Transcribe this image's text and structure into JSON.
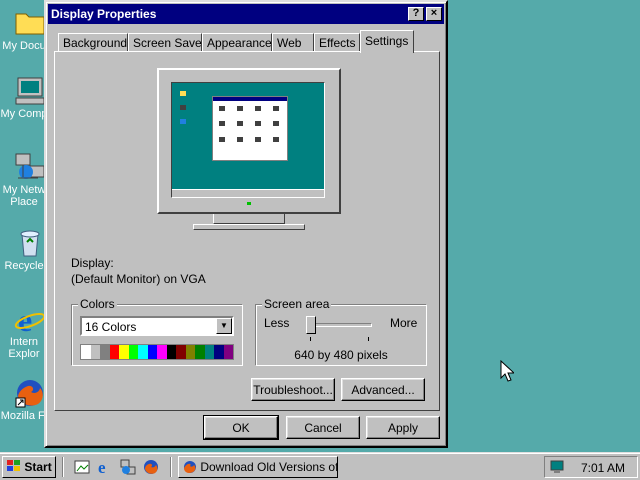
{
  "desktop": {
    "icons": [
      {
        "label": "My Docu",
        "icon": "folder-icon"
      },
      {
        "label": "My Comp",
        "icon": "computer-icon"
      },
      {
        "label": "My Netw",
        "label2": "Place",
        "icon": "network-icon"
      },
      {
        "label": "Recycle",
        "icon": "recycle-bin-icon"
      },
      {
        "label": "Intern",
        "label2": "Explor",
        "icon": "internet-explorer-icon"
      },
      {
        "label": "Mozilla Fi",
        "icon": "firefox-icon"
      }
    ]
  },
  "window": {
    "title": "Display Properties",
    "help_button": "?",
    "close_button": "×",
    "tabs": [
      "Background",
      "Screen Saver",
      "Appearance",
      "Web",
      "Effects",
      "Settings"
    ],
    "active_tab": "Settings",
    "display_label": "Display:",
    "display_value": "(Default Monitor) on VGA",
    "colors": {
      "legend": "Colors",
      "selected": "16 Colors",
      "palette": [
        "#ffffff",
        "#c0c0c0",
        "#808080",
        "#ff0000",
        "#ffff00",
        "#00ff00",
        "#00ffff",
        "#0000ff",
        "#ff00ff",
        "#000000",
        "#800000",
        "#808000",
        "#008000",
        "#008080",
        "#000080",
        "#800080"
      ]
    },
    "screen_area": {
      "legend": "Screen area",
      "less": "Less",
      "more": "More",
      "value": "640 by 480 pixels",
      "slider_level": 0
    },
    "buttons": {
      "troubleshoot": "Troubleshoot...",
      "advanced": "Advanced...",
      "ok": "OK",
      "cancel": "Cancel",
      "apply": "Apply"
    }
  },
  "taskbar": {
    "start": "Start",
    "task": "Download Old Versions of...",
    "clock": "7:01 AM"
  }
}
